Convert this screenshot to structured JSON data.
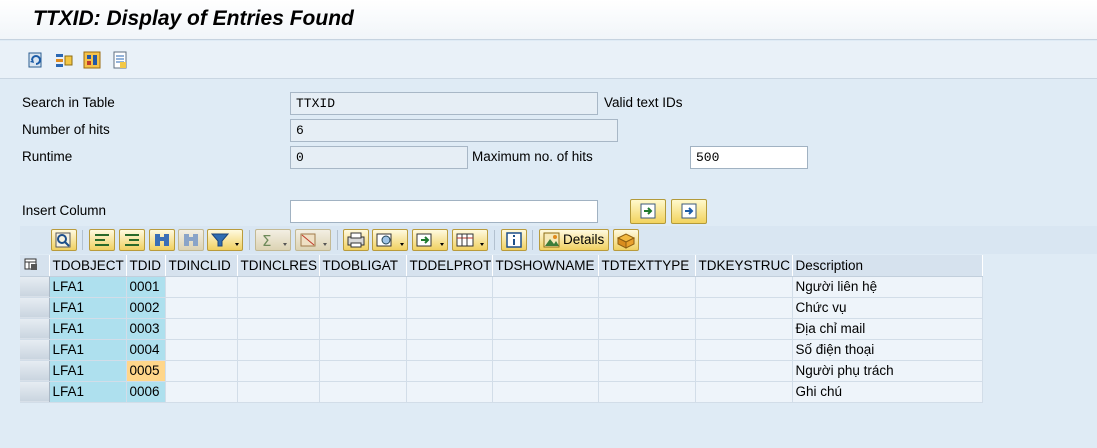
{
  "window": {
    "title": "TTXID: Display of Entries Found"
  },
  "toolbar": {
    "icons": [
      "refresh-icon",
      "selection-options-icon",
      "multiple-selection-icon",
      "list-icon"
    ]
  },
  "form": {
    "search_label": "Search in Table",
    "search_value": "TTXID",
    "search_desc": "Valid text IDs",
    "hits_label": "Number of hits",
    "hits_value": "6",
    "runtime_label": "Runtime",
    "runtime_value": "0",
    "max_hits_label": "Maximum no. of hits",
    "max_hits_value": "500",
    "insert_col_label": "Insert Column",
    "insert_col_value": ""
  },
  "alv_toolbar": {
    "details_label": "Details"
  },
  "grid": {
    "columns": [
      "TDOBJECT",
      "TDID",
      "TDINCLID",
      "TDINCLRES",
      "TDOBLIGAT",
      "TDDELPROT",
      "TDSHOWNAME",
      "TDTEXTTYPE",
      "TDKEYSTRUC",
      "Description"
    ],
    "rows": [
      {
        "tdobject": "LFA1",
        "tdid": "0001",
        "description": "Người liên hệ"
      },
      {
        "tdobject": "LFA1",
        "tdid": "0002",
        "description": "Chức vụ"
      },
      {
        "tdobject": "LFA1",
        "tdid": "0003",
        "description": "Địa chỉ mail"
      },
      {
        "tdobject": "LFA1",
        "tdid": "0004",
        "description": "Số điện thoại"
      },
      {
        "tdobject": "LFA1",
        "tdid": "0005",
        "description": "Người phụ trách"
      },
      {
        "tdobject": "LFA1",
        "tdid": "0006",
        "description": "Ghi chú"
      }
    ],
    "selected_cell": {
      "row": 4,
      "column": "TDID"
    }
  },
  "colors": {
    "key_column": "#aee0ee",
    "selected_cell": "#ffd68a",
    "background": "#dfebf5"
  }
}
